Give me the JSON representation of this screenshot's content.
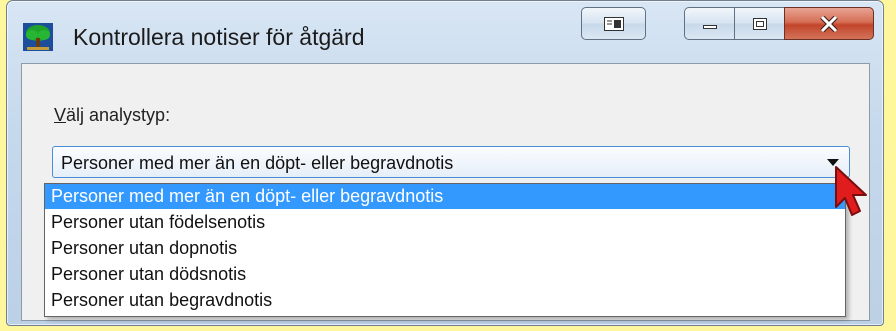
{
  "window": {
    "title": "Kontrollera notiser för åtgärd"
  },
  "form": {
    "label_accel": "V",
    "label_rest": "älj analystyp:",
    "selected": "Personer med mer än en döpt- eller begravdnotis",
    "options": [
      "Personer med mer än en döpt- eller begravdnotis",
      "Personer utan födelsenotis",
      "Personer utan dopnotis",
      "Personer utan dödsnotis",
      "Personer utan begravdnotis"
    ]
  },
  "colors": {
    "highlight": "#3399ff",
    "close_button": "#c7472d",
    "pointer": "#e01c1c",
    "background": "#fff79e"
  },
  "icons": {
    "app": "tree-icon",
    "share": "dual-pane-icon",
    "minimize": "minimize-icon",
    "maximize": "maximize-icon",
    "close": "close-icon",
    "dropdown": "dropdown-arrow-icon",
    "pointer": "mouse-pointer-icon"
  }
}
